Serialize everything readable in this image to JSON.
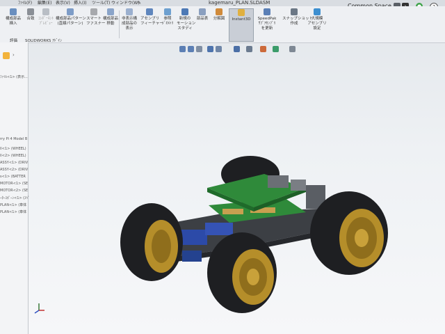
{
  "menu": {
    "items": [
      "ﾌｧｲﾙ(F)",
      "編集(E)",
      "表示(V)",
      "挿入(I)",
      "ツール(T)",
      "ウィンドウ(W)"
    ],
    "pin": "✎"
  },
  "window": {
    "title": "kagemaru_PLAN.SLDASM",
    "search_space": "Common Space"
  },
  "ribbon": {
    "buttons": [
      {
        "label": "構成部品\n挿入"
      },
      {
        "label": "合致"
      },
      {
        "label": "ｺﾝﾎﾟｰﾈﾝﾄ\nﾌﾟﾚﾋﾞｭｰ"
      },
      {
        "label": "構成部品パターン\n(直線パターン)"
      },
      {
        "label": "スマート\nファスナー"
      },
      {
        "label": "構成部品\n移動"
      },
      {
        "label": "非表示構\n成部品の\n表示"
      },
      {
        "label": "アセンブリ\nフィーチャー"
      },
      {
        "label": "参照\nｼﾞｵﾒﾄﾘ"
      },
      {
        "label": "新規の\nモーション\nスタディ"
      },
      {
        "label": "部品表"
      },
      {
        "label": "分解図"
      },
      {
        "label": "Instant3D"
      },
      {
        "label": "SpeedPak\nｻﾌﾞｱｾﾝﾌﾞﾘ\nを更新"
      },
      {
        "label": "スナップショット\n作成"
      },
      {
        "label": "大規模\nアセンブリ\n設定"
      }
    ]
  },
  "tabs": [
    "評価",
    "SOLIDWORKS ｱﾄﾞｲﾝ"
  ],
  "tree": {
    "items": [
      "ﾌｧｲﾙ<1> (表示...",
      "rry Pi 4 Model B",
      "ll<1> (WHEEL)",
      "ll<2> (WHEEL)",
      "ASSY<1> (DRIV",
      "ASSY<2> (DRIV",
      "s<1> (BATTER",
      "MOTOR<1> (SE",
      "MOTOR<2> (SE",
      "ｰﾀｰｽﾎﾟｰﾝ<1> (ｽﾍﾟ",
      "PLAN<1> (車体",
      "PLAN<1> (車体"
    ]
  },
  "colors": {
    "pcb": "#2f8a3a",
    "rim": "#b58e2a",
    "tire": "#1e1f22",
    "chassis": "#3c3f44",
    "motor": "#2c4aa8",
    "accent": "#f0a020"
  }
}
